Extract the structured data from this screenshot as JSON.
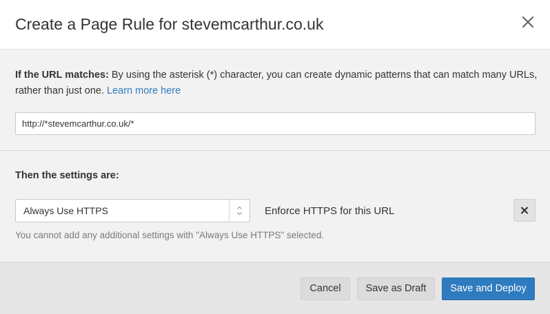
{
  "modal": {
    "title": "Create a Page Rule for stevemcarthur.co.uk"
  },
  "url_section": {
    "label": "If the URL matches:",
    "description": " By using the asterisk (*) character, you can create dynamic patterns that can match many URLs, rather than just one. ",
    "learn_more": "Learn more here",
    "url_value": "http://*stevemcarthur.co.uk/*"
  },
  "settings_section": {
    "heading": "Then the settings are:",
    "selected_setting": "Always Use HTTPS",
    "setting_description": "Enforce HTTPS for this URL",
    "notice": "You cannot add any additional settings with \"Always Use HTTPS\" selected."
  },
  "footer": {
    "cancel_label": "Cancel",
    "draft_label": "Save as Draft",
    "deploy_label": "Save and Deploy"
  },
  "icons": {
    "close": "close-icon",
    "select_arrows": "chevron-up-down-icon",
    "remove": "remove-icon"
  },
  "colors": {
    "accent": "#2f7bbf",
    "link": "#2f7bbf",
    "footer_bg": "#e6e6e6",
    "body_bg": "#f2f2f2"
  }
}
